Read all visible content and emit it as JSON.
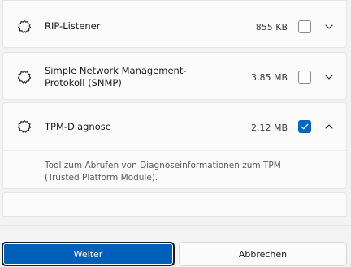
{
  "features": [
    {
      "name": "RIP-Listener",
      "size": "855 KB",
      "checked": false,
      "expanded": false,
      "icon": "puzzle-gear-icon",
      "chevron": "chevron-down-icon"
    },
    {
      "name": "Simple Network Management-Protokoll (SNMP)",
      "size": "3,85 MB",
      "checked": false,
      "expanded": false,
      "icon": "puzzle-gear-icon",
      "chevron": "chevron-down-icon"
    },
    {
      "name": "TPM-Diagnose",
      "size": "2,12 MB",
      "checked": true,
      "expanded": true,
      "description": "Tool zum Abrufen von Diagnoseinformationen zum TPM (Trusted Platform Module).",
      "icon": "puzzle-gear-icon",
      "chevron": "chevron-up-icon"
    }
  ],
  "buttons": {
    "primary": "Weiter",
    "secondary": "Abbrechen"
  },
  "colors": {
    "accent": "#0067c0",
    "primary_button": "#005fb8"
  }
}
